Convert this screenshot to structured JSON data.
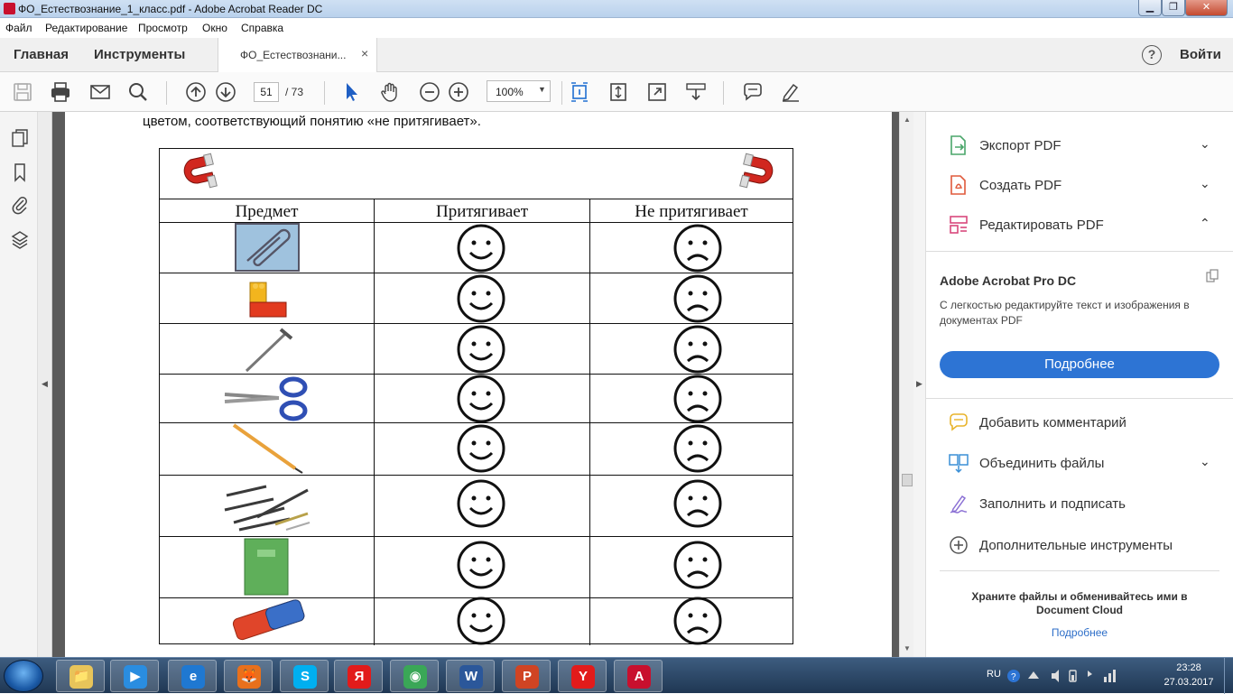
{
  "window": {
    "title": "ФО_Естествознание_1_класс.pdf - Adobe Acrobat Reader DC",
    "min_glyph": "▁",
    "max_glyph": "❐",
    "close_glyph": "✕"
  },
  "menu": [
    "Файл",
    "Редактирование",
    "Просмотр",
    "Окно",
    "Справка"
  ],
  "tabs": {
    "home": "Главная",
    "tools": "Инструменты",
    "document": "ФО_Естествознани...",
    "close_glyph": "×"
  },
  "help_glyph": "?",
  "signin": "Войти",
  "toolbar": {
    "page_current": "51",
    "page_total": "/ 73",
    "zoom": "100%",
    "zoom_caret": "▼"
  },
  "document": {
    "instruction": "цветом, соответствующий понятию «не притягивает».",
    "headers": {
      "item": "Предмет",
      "attracts": "Притягивает",
      "not_attracts": "Не притягивает"
    },
    "rows": [
      {
        "item": "paperclip-icon"
      },
      {
        "item": "lego-brick-icon"
      },
      {
        "item": "nail-icon"
      },
      {
        "item": "scissors-icon"
      },
      {
        "item": "pencil-icon"
      },
      {
        "item": "screws-icon"
      },
      {
        "item": "notebook-icon"
      },
      {
        "item": "eraser-icon"
      }
    ],
    "colors": {
      "paperclip_bg": "#9fc2de",
      "lego": "#e23a1f",
      "lego_top": "#f2b51e",
      "scissors": "#2f4fb4",
      "pencil": "#e9a23b",
      "notebook": "#5faf5a",
      "eraser": "#e0452a",
      "eraser_band": "#3a6fc8",
      "magnet": "#d1271f"
    }
  },
  "right_panel": {
    "tools_top": [
      {
        "label": "Экспорт PDF",
        "icon": "export-pdf-icon",
        "chevron": "⌄"
      },
      {
        "label": "Создать PDF",
        "icon": "create-pdf-icon",
        "chevron": "⌄"
      },
      {
        "label": "Редактировать PDF",
        "icon": "edit-pdf-icon",
        "chevron": "⌃"
      }
    ],
    "promo": {
      "title": "Adobe Acrobat Pro DC",
      "description": "С легкостью редактируйте текст и изображения в документах PDF",
      "button": "Подробнее"
    },
    "tools_bottom": [
      {
        "label": "Добавить комментарий",
        "icon": "comment-icon"
      },
      {
        "label": "Объединить файлы",
        "icon": "combine-files-icon",
        "chevron": "⌄"
      },
      {
        "label": "Заполнить и подписать",
        "icon": "fill-sign-icon"
      },
      {
        "label": "Дополнительные инструменты",
        "icon": "more-tools-icon"
      }
    ],
    "cloud_text": "Храните файлы и обменивайтесь ими в Document Cloud",
    "cloud_link": "Подробнее"
  },
  "taskbar": {
    "apps": [
      {
        "name": "explorer",
        "glyph": "📁",
        "color": "#e7c45a"
      },
      {
        "name": "media-player",
        "glyph": "▶",
        "color": "#2a8de0"
      },
      {
        "name": "internet-explorer",
        "glyph": "e",
        "color": "#1f78d1"
      },
      {
        "name": "firefox",
        "glyph": "🦊",
        "color": "#e8701c"
      },
      {
        "name": "skype",
        "glyph": "S",
        "color": "#00aff0"
      },
      {
        "name": "yandex",
        "glyph": "Я",
        "color": "#e21b1b"
      },
      {
        "name": "chrome",
        "glyph": "◉",
        "color": "#3aa757"
      },
      {
        "name": "word",
        "glyph": "W",
        "color": "#2b579a"
      },
      {
        "name": "powerpoint",
        "glyph": "P",
        "color": "#d04423"
      },
      {
        "name": "yandex-browser",
        "glyph": "Y",
        "color": "#e21b1b"
      },
      {
        "name": "acrobat",
        "glyph": "A",
        "color": "#c8102e"
      }
    ],
    "lang": "RU",
    "time": "23:28",
    "date": "27.03.2017"
  }
}
